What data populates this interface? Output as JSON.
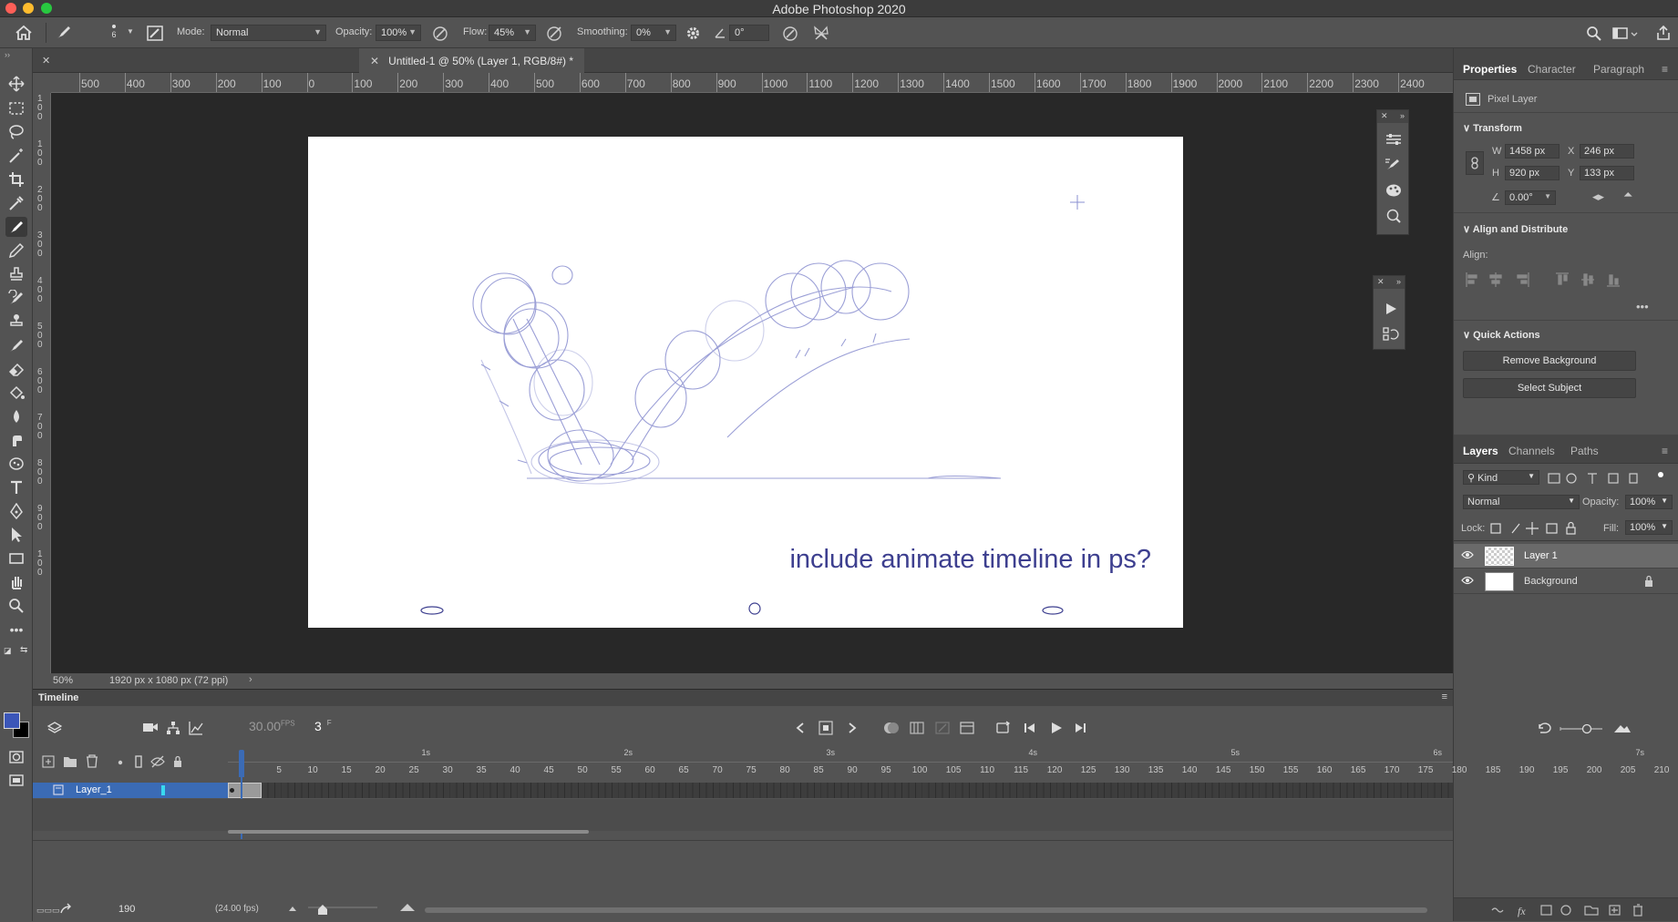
{
  "app": {
    "title": "Adobe Photoshop 2020"
  },
  "options": {
    "brush_size": "6",
    "mode_label": "Mode:",
    "mode_value": "Normal",
    "opacity_label": "Opacity:",
    "opacity_value": "100%",
    "flow_label": "Flow:",
    "flow_value": "45%",
    "smoothing_label": "Smoothing:",
    "smoothing_value": "0%",
    "angle_value": "0°"
  },
  "document": {
    "tab": "Untitled-1 @ 50% (Layer 1, RGB/8#) *"
  },
  "ruler": {
    "h": [
      "500",
      "400",
      "300",
      "200",
      "100",
      "0",
      "100",
      "200",
      "300",
      "400",
      "500",
      "600",
      "700",
      "800",
      "900",
      "1000",
      "1100",
      "1200",
      "1300",
      "1400",
      "1500",
      "1600",
      "1700",
      "1800",
      "1900",
      "2000",
      "2100",
      "2200",
      "2300",
      "2400"
    ],
    "v": [
      "1\n0\n0",
      "1\n0\n0",
      "2\n0\n0",
      "3\n0\n0",
      "4\n0\n0",
      "5\n0\n0",
      "6\n0\n0",
      "7\n0\n0",
      "8\n0\n0",
      "9\n0\n0",
      "1\n0\n0"
    ]
  },
  "canvas": {
    "text": "include animate timeline in ps?",
    "ink_color": "#3d3f8f",
    "sketch_color": "#7a7fc6"
  },
  "status": {
    "zoom": "50%",
    "doc_info": "1920 px x 1080 px (72 ppi)"
  },
  "properties": {
    "tabs": [
      "Properties",
      "Character",
      "Paragraph"
    ],
    "layer_kind": "Pixel Layer",
    "transform_title": "Transform",
    "w_label": "W",
    "w_value": "1458 px",
    "h_label": "H",
    "h_value": "920 px",
    "x_label": "X",
    "x_value": "246 px",
    "y_label": "Y",
    "y_value": "133 px",
    "angle_value": "0.00°",
    "align_title": "Align and Distribute",
    "align_label": "Align:",
    "quick_title": "Quick Actions",
    "remove_bg": "Remove Background",
    "select_subject": "Select Subject"
  },
  "layers_panel": {
    "tabs": [
      "Layers",
      "Channels",
      "Paths"
    ],
    "kind": "Kind",
    "blend": "Normal",
    "opacity_label": "Opacity:",
    "opacity_value": "100%",
    "lock_label": "Lock:",
    "fill_label": "Fill:",
    "fill_value": "100%",
    "layers": [
      {
        "name": "Layer 1"
      },
      {
        "name": "Background"
      }
    ]
  },
  "timeline": {
    "title": "Timeline",
    "fps": "30.00",
    "fps_unit": "FPS",
    "frame": "3",
    "frame_unit": "F",
    "layer_name": "Layer_1",
    "seconds": [
      "1s",
      "2s",
      "3s",
      "4s",
      "5s",
      "6s",
      "7s"
    ],
    "frames": [
      "5",
      "10",
      "15",
      "20",
      "25",
      "30",
      "35",
      "40",
      "45",
      "50",
      "55",
      "60",
      "65",
      "70",
      "75",
      "80",
      "85",
      "90",
      "95",
      "100",
      "105",
      "110",
      "115",
      "120",
      "125",
      "130",
      "135",
      "140",
      "145",
      "150",
      "155",
      "160",
      "165",
      "170",
      "175",
      "180",
      "185",
      "190",
      "195",
      "200",
      "205",
      "210"
    ],
    "bottom_frame": "190",
    "bottom_fps": "(24.00 fps)",
    "accent": "#3b6bb5"
  }
}
